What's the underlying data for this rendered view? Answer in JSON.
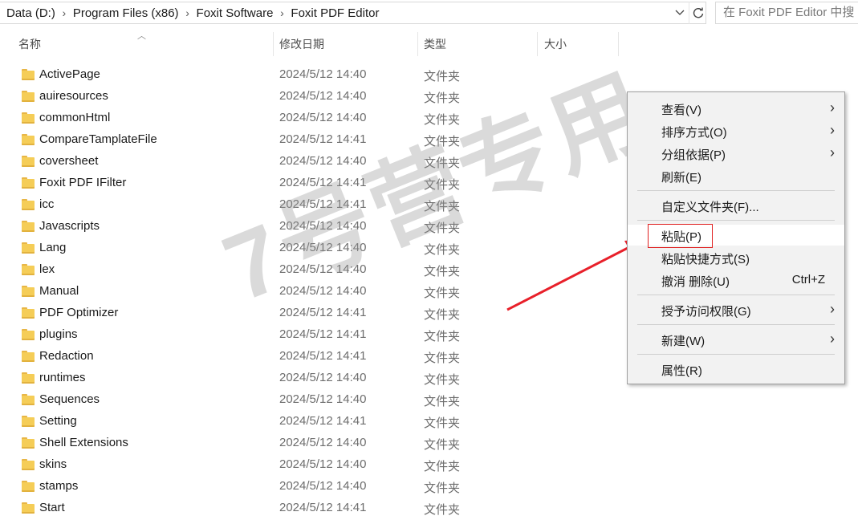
{
  "address": {
    "crumbs": [
      "Data (D:)",
      "Program Files (x86)",
      "Foxit Software",
      "Foxit PDF Editor"
    ],
    "search_placeholder": "在 Foxit PDF Editor 中搜"
  },
  "columns": {
    "name": "名称",
    "modified": "修改日期",
    "type": "类型",
    "size": "大小"
  },
  "files": [
    {
      "name": "ActivePage",
      "date": "2024/5/12 14:40",
      "type": "文件夹"
    },
    {
      "name": "auiresources",
      "date": "2024/5/12 14:40",
      "type": "文件夹"
    },
    {
      "name": "commonHtml",
      "date": "2024/5/12 14:40",
      "type": "文件夹"
    },
    {
      "name": "CompareTamplateFile",
      "date": "2024/5/12 14:41",
      "type": "文件夹"
    },
    {
      "name": "coversheet",
      "date": "2024/5/12 14:40",
      "type": "文件夹"
    },
    {
      "name": "Foxit PDF IFilter",
      "date": "2024/5/12 14:41",
      "type": "文件夹"
    },
    {
      "name": "icc",
      "date": "2024/5/12 14:41",
      "type": "文件夹"
    },
    {
      "name": "Javascripts",
      "date": "2024/5/12 14:40",
      "type": "文件夹"
    },
    {
      "name": "Lang",
      "date": "2024/5/12 14:40",
      "type": "文件夹"
    },
    {
      "name": "lex",
      "date": "2024/5/12 14:40",
      "type": "文件夹"
    },
    {
      "name": "Manual",
      "date": "2024/5/12 14:40",
      "type": "文件夹"
    },
    {
      "name": "PDF Optimizer",
      "date": "2024/5/12 14:41",
      "type": "文件夹"
    },
    {
      "name": "plugins",
      "date": "2024/5/12 14:41",
      "type": "文件夹"
    },
    {
      "name": "Redaction",
      "date": "2024/5/12 14:41",
      "type": "文件夹"
    },
    {
      "name": "runtimes",
      "date": "2024/5/12 14:40",
      "type": "文件夹"
    },
    {
      "name": "Sequences",
      "date": "2024/5/12 14:40",
      "type": "文件夹"
    },
    {
      "name": "Setting",
      "date": "2024/5/12 14:41",
      "type": "文件夹"
    },
    {
      "name": "Shell Extensions",
      "date": "2024/5/12 14:40",
      "type": "文件夹"
    },
    {
      "name": "skins",
      "date": "2024/5/12 14:40",
      "type": "文件夹"
    },
    {
      "name": "stamps",
      "date": "2024/5/12 14:40",
      "type": "文件夹"
    },
    {
      "name": "Start",
      "date": "2024/5/12 14:41",
      "type": "文件夹"
    }
  ],
  "context_menu": {
    "view": "查看(V)",
    "sort_by": "排序方式(O)",
    "group_by": "分组依据(P)",
    "refresh": "刷新(E)",
    "customize_folder": "自定义文件夹(F)...",
    "paste": "粘贴(P)",
    "paste_shortcut": "粘贴快捷方式(S)",
    "undo_delete": "撤消 删除(U)",
    "undo_shortcut": "Ctrl+Z",
    "give_access": "授予访问权限(G)",
    "new": "新建(W)",
    "properties": "属性(R)"
  },
  "watermark": "7号营专用",
  "colors": {
    "highlight_box": "#e02020",
    "arrow": "#e8202a",
    "folder": "#f5cd57"
  }
}
